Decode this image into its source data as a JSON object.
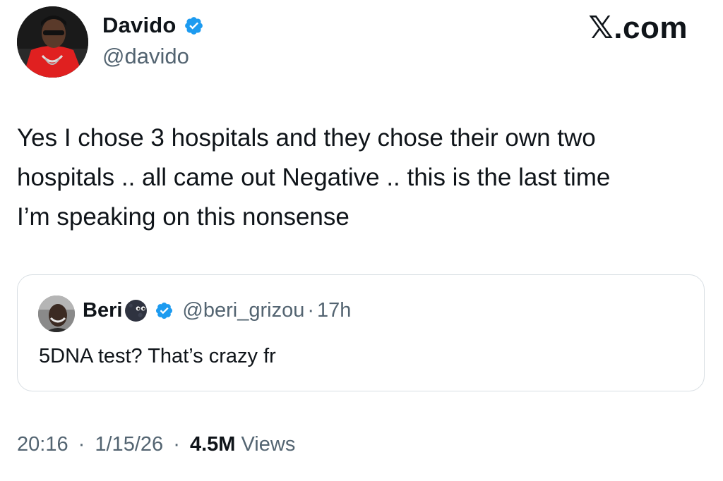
{
  "author": {
    "name": "Davido",
    "handle": "@davido",
    "verified_color": "#1d9bf0"
  },
  "brand": {
    "label": "𝕏.com"
  },
  "tweet": {
    "text": "Yes I chose 3 hospitals and they chose their own two\nhospitals .. all came out Negative .. this is the last time\nI’m speaking on this nonsense"
  },
  "quoted_tweet": {
    "name": "Beri",
    "emoji": "new-moon-face-icon",
    "handle": "@beri_grizou",
    "separator": "·",
    "time": "17h",
    "text": "5DNA test? That’s crazy fr"
  },
  "meta": {
    "time": "20:16",
    "separator": "·",
    "date": "1/15/26",
    "views_count": "4.5M",
    "views_label": "Views"
  }
}
